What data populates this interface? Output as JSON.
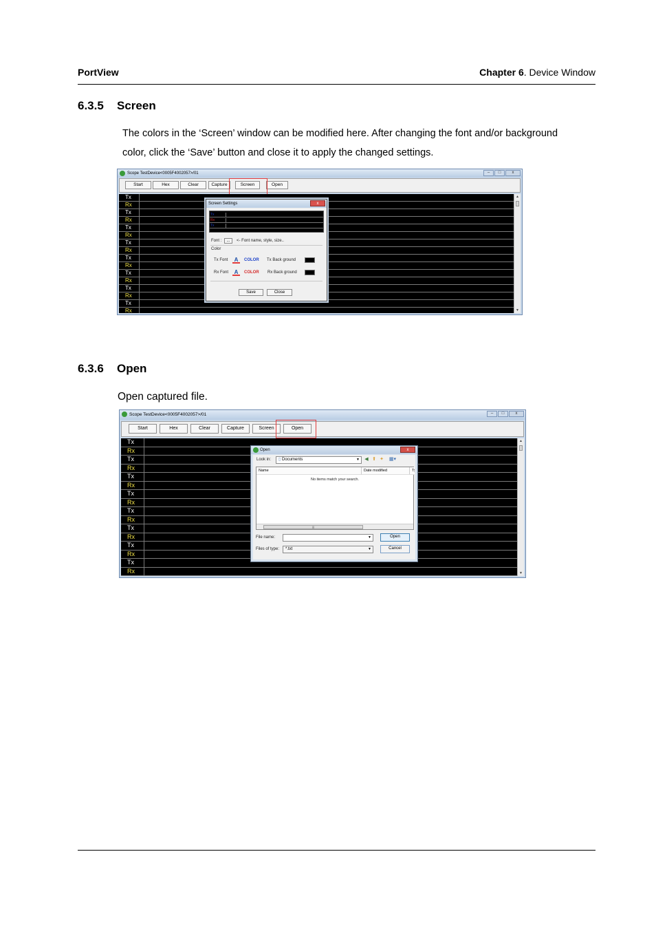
{
  "header": {
    "product": "PortView",
    "chapter_bold": "Chapter 6",
    "chapter_rest": ". Device Window"
  },
  "section_screen": {
    "number": "6.3.5",
    "title": "Screen",
    "line1": "The colors in the ‘Screen’ window can be modified here. After changing the font and/or background",
    "line2": "color, click the ‘Save’ button and close it to apply the changed settings."
  },
  "section_open": {
    "number": "6.3.6",
    "title": "Open",
    "text": "Open captured file."
  },
  "shot1": {
    "window_title": "Scope TestDevice<0005F4002057>/01",
    "buttons": [
      "Start",
      "Hex",
      "Clear",
      "Capture",
      "Screen",
      "Open"
    ],
    "rows": [
      "Tx",
      "Rx",
      "Tx",
      "Rx",
      "Tx",
      "Rx",
      "Tx",
      "Rx",
      "Tx",
      "Rx",
      "Tx",
      "Rx",
      "Tx",
      "Rx",
      "Tx",
      "Rx"
    ],
    "dialog": {
      "title": "Screen Settings",
      "close": "x",
      "preview_rows": [
        "Tx",
        "Rx",
        "Tx"
      ],
      "font_label": "Font :",
      "font_btn": "...",
      "font_hint": "<- Font name, style, size..",
      "color_label": "Color",
      "tx_font": "Tx Font",
      "rx_font": "Rx Font",
      "color_word": "COLOR",
      "tx_back": "Tx Back ground",
      "rx_back": "Rx Back ground",
      "save": "Save",
      "close_btn": "Close",
      "tx_color": "#1a3fc9",
      "rx_color": "#d42a2a"
    }
  },
  "shot2": {
    "window_title": "Scope TestDevice<0005F4002057>/01",
    "buttons": [
      "Start",
      "Hex",
      "Clear",
      "Capture",
      "Screen",
      "Open"
    ],
    "rows": [
      "Tx",
      "Rx",
      "Tx",
      "Rx",
      "Tx",
      "Rx",
      "Tx",
      "Rx",
      "Tx",
      "Rx",
      "Tx",
      "Rx",
      "Tx",
      "Rx",
      "Tx",
      "Rx"
    ],
    "dialog": {
      "title": "Open",
      "close": "x",
      "look_in_label": "Look in:",
      "look_in_value": "Documents",
      "col_name": "Name",
      "col_date": "Date modified",
      "col_type": "Ty",
      "empty": "No items match your search.",
      "file_name_label": "File name:",
      "file_name_value": "",
      "files_type_label": "Files of type:",
      "files_type_value": "*.txt",
      "open_btn": "Open",
      "cancel_btn": "Cancel"
    }
  },
  "colors": {
    "rx_label": "#f0e14a",
    "tx_label": "#ffffff",
    "highlight": "#e23b3b"
  }
}
